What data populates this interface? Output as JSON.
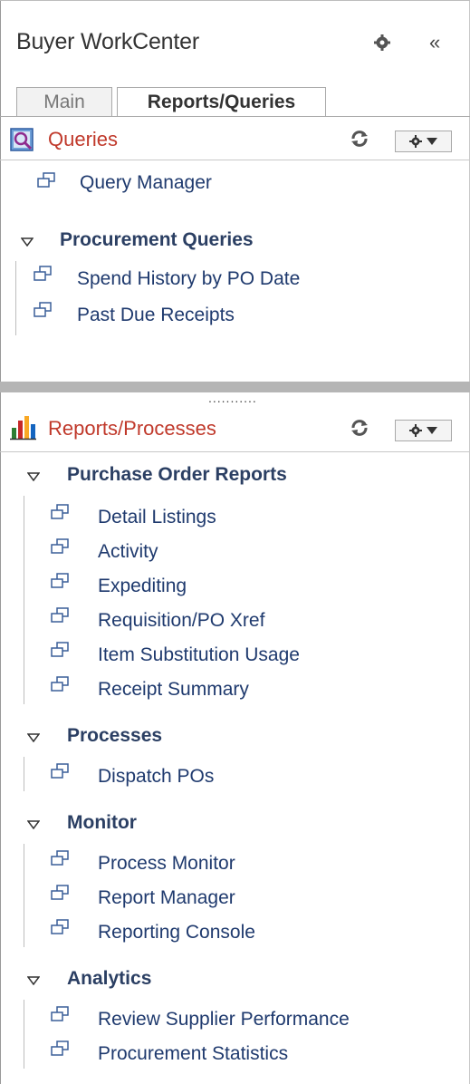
{
  "header": {
    "title": "Buyer WorkCenter"
  },
  "tabs": [
    {
      "label": "Main",
      "selected": false
    },
    {
      "label": "Reports/Queries",
      "selected": true
    }
  ],
  "queries": {
    "title": "Queries",
    "top_items": [
      {
        "label": "Query Manager"
      }
    ],
    "groups": [
      {
        "label": "Procurement Queries",
        "items": [
          {
            "label": "Spend History by PO Date"
          },
          {
            "label": "Past Due Receipts"
          }
        ]
      }
    ]
  },
  "reports": {
    "title": "Reports/Processes",
    "groups": [
      {
        "label": "Purchase Order Reports",
        "items": [
          {
            "label": "Detail Listings"
          },
          {
            "label": "Activity"
          },
          {
            "label": "Expediting"
          },
          {
            "label": "Requisition/PO Xref"
          },
          {
            "label": "Item Substitution Usage"
          },
          {
            "label": "Receipt Summary"
          }
        ]
      },
      {
        "label": "Processes",
        "items": [
          {
            "label": "Dispatch POs"
          }
        ]
      },
      {
        "label": "Monitor",
        "items": [
          {
            "label": "Process Monitor"
          },
          {
            "label": "Report Manager"
          },
          {
            "label": "Reporting Console"
          }
        ]
      },
      {
        "label": "Analytics",
        "items": [
          {
            "label": "Review Supplier Performance"
          },
          {
            "label": "Procurement Statistics"
          }
        ]
      }
    ]
  },
  "splitter": {
    "grip": "..........."
  },
  "icons": {
    "settings": "gear-icon",
    "collapse": "double-chevron-left-icon",
    "refresh": "refresh-icon",
    "options": "gear-dropdown-icon",
    "link": "window-link-icon",
    "expanded": "triangle-down-icon",
    "queries": "query-icon",
    "reports": "bar-chart-icon"
  },
  "colors": {
    "pagelet_title": "#c0392b",
    "link": "#1f3a6e",
    "splitter": "#b5b5b5"
  }
}
